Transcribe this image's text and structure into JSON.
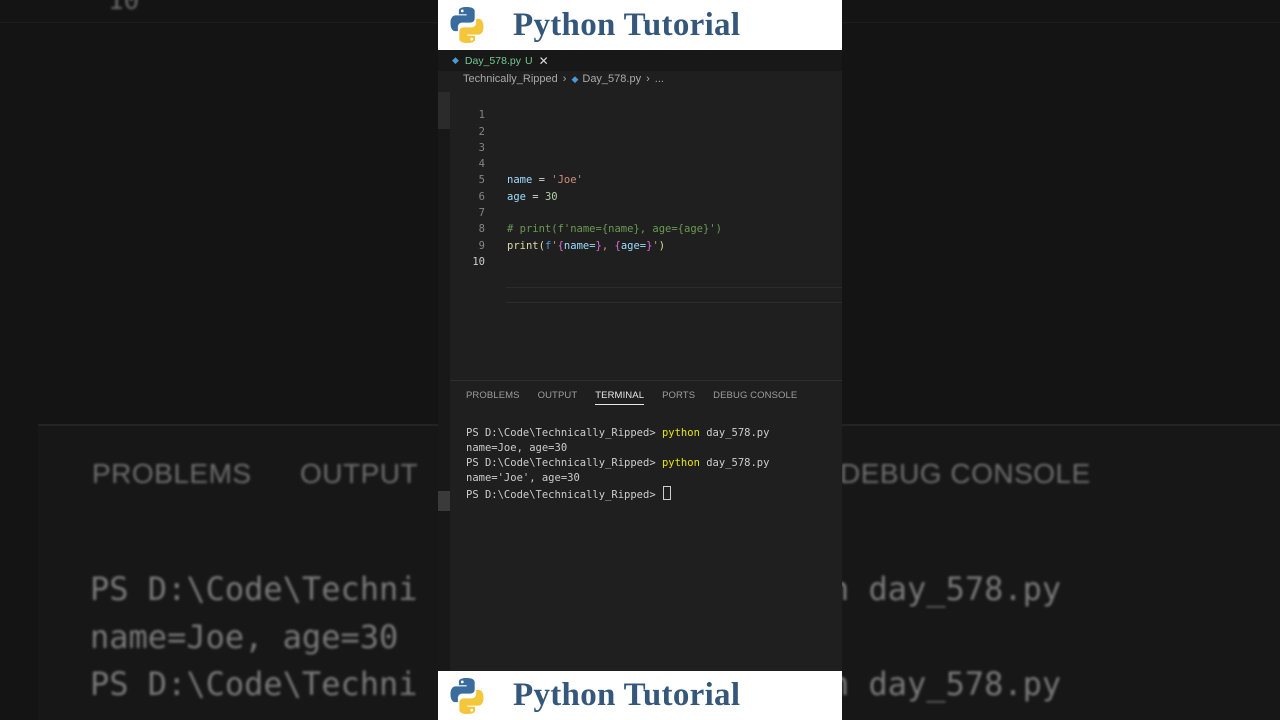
{
  "background": {
    "line_number": "10",
    "tabs": [
      "PROBLEMS",
      "OUTPUT",
      "DEBUG CONSOLE"
    ],
    "terminal_left": [
      "PS D:\\Code\\Techni",
      "name=Joe, age=30",
      "PS D:\\Code\\Techni"
    ],
    "terminal_right": [
      "n day_578.py",
      "n day_578.py"
    ]
  },
  "banner": {
    "title": "Python Tutorial",
    "icon": "python-logo-icon"
  },
  "editor": {
    "tab_name": "Day_578.py",
    "tab_status": "U",
    "breadcrumb": [
      "Technically_Ripped",
      "Day_578.py",
      "..."
    ],
    "line_numbers": [
      "1",
      "2",
      "3",
      "4",
      "5",
      "6",
      "7",
      "8",
      "9",
      "10"
    ],
    "code": {
      "l4_var": "name",
      "l4_op": " = ",
      "l4_str": "'Joe'",
      "l5_var": "age",
      "l5_op": " = ",
      "l5_num": "30",
      "l7_comment": "# print(f'name={name}, age={age}')",
      "l8_fn": "print",
      "l8_open": "(",
      "l8_f": "f",
      "l8_q1": "'",
      "l8_b1": "{",
      "l8_e1": "name=",
      "l8_b2": "}",
      "l8_sep": ", ",
      "l8_b3": "{",
      "l8_e2": "age=",
      "l8_b4": "}",
      "l8_q2": "'",
      "l8_close": ")"
    }
  },
  "panel": {
    "tabs": [
      "PROBLEMS",
      "OUTPUT",
      "TERMINAL",
      "PORTS",
      "DEBUG CONSOLE"
    ],
    "active_tab": "TERMINAL",
    "terminal": {
      "prompt": "PS D:\\Code\\Technically_Ripped> ",
      "cmd1": "python",
      "arg1": " day_578.py",
      "out1": "name=Joe, age=30",
      "cmd2": "python",
      "arg2": " day_578.py",
      "out2": "name='Joe', age=30"
    }
  },
  "colors": {
    "banner_text": "#35577a",
    "editor_bg": "#1f1f1f",
    "modified_tab": "#73c991",
    "terminal_cmd": "#e5e510"
  }
}
